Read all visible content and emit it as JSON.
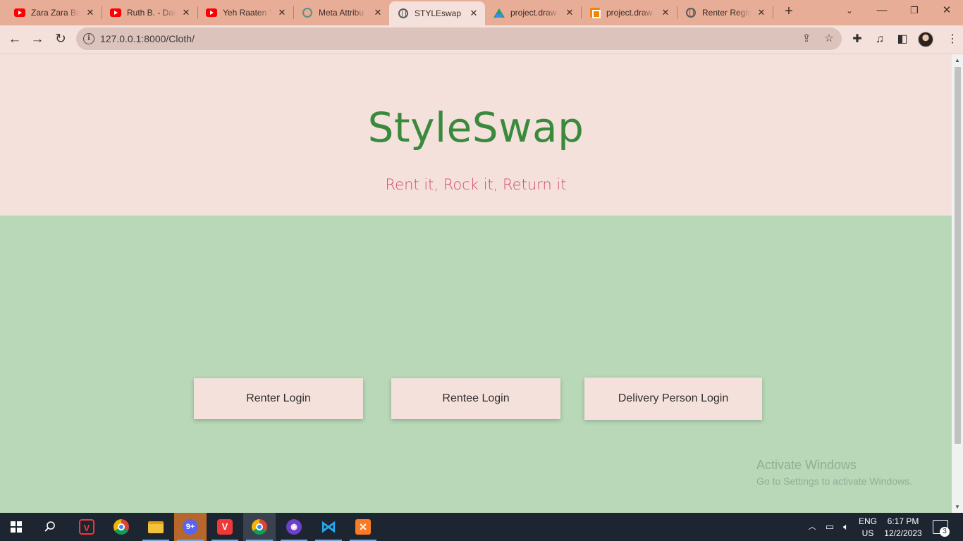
{
  "browser": {
    "tabs": [
      {
        "label": "Zara Zara Ba",
        "icon": "youtube-icon"
      },
      {
        "label": "Ruth B. - Dar",
        "icon": "youtube-icon"
      },
      {
        "label": "Yeh Raaten Y",
        "icon": "youtube-icon"
      },
      {
        "label": "Meta Attribu",
        "icon": "chatgpt-icon"
      },
      {
        "label": "STYLEswap",
        "icon": "globe-icon",
        "active": true
      },
      {
        "label": "project.draw",
        "icon": "google-drive-icon"
      },
      {
        "label": "project.draw",
        "icon": "drawio-icon"
      },
      {
        "label": "Renter Regis",
        "icon": "globe-icon"
      }
    ],
    "url": "127.0.0.1:8000/Cloth/"
  },
  "page": {
    "brand": "StyleSwap",
    "tagline": "Rent it, Rock it, Return it",
    "buttons": {
      "renter": "Renter Login",
      "rentee": "Rentee Login",
      "delivery": "Delivery Person Login"
    },
    "watermark": {
      "title": "Activate Windows",
      "subtitle": "Go to Settings to activate Windows."
    }
  },
  "taskbar": {
    "apps": [
      "windows-start",
      "search",
      "vivaldi",
      "chrome",
      "file-explorer",
      "discord",
      "vivaldi",
      "chrome",
      "github-desktop",
      "vs-code",
      "xampp"
    ],
    "language": "ENG",
    "region": "US",
    "time": "6:17 PM",
    "date": "12/2/2023",
    "notifications": "3"
  },
  "colors": {
    "brand_green": "#3a8a3e",
    "tagline_pink": "#d2506b",
    "header_bg": "#f5e1dc",
    "main_bg": "#b8d8b8",
    "tabstrip_bg": "#e8ad97"
  }
}
